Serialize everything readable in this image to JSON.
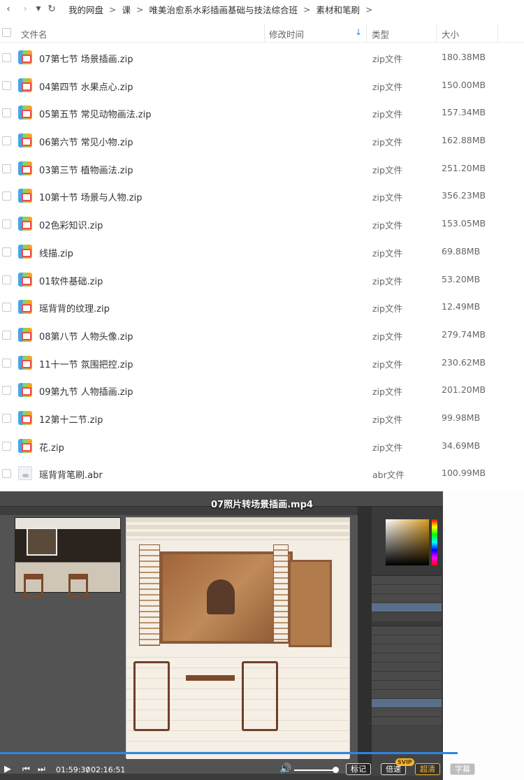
{
  "breadcrumb": {
    "back_icon": "chevron-left-icon",
    "forward_icon": "chevron-right-icon",
    "history_icon": "caret-down-icon",
    "refresh_icon": "refresh-icon",
    "items": [
      "我的网盘",
      "课",
      "唯美治愈系水彩插画基础与技法综合班",
      "素材和笔刷"
    ],
    "separator": ">"
  },
  "table": {
    "headers": {
      "name": "文件名",
      "mtime": "修改时间",
      "type": "类型",
      "size": "大小"
    },
    "sort_icon": "arrow-down-icon",
    "rows": [
      {
        "name": "07第七节 场景插画.zip",
        "type": "zip文件",
        "size": "180.38MB",
        "icon": "zip-file-icon"
      },
      {
        "name": "04第四节 水果点心.zip",
        "type": "zip文件",
        "size": "150.00MB",
        "icon": "zip-file-icon"
      },
      {
        "name": "05第五节 常见动物画法.zip",
        "type": "zip文件",
        "size": "157.34MB",
        "icon": "zip-file-icon"
      },
      {
        "name": "06第六节 常见小物.zip",
        "type": "zip文件",
        "size": "162.88MB",
        "icon": "zip-file-icon"
      },
      {
        "name": "03第三节 植物画法.zip",
        "type": "zip文件",
        "size": "251.20MB",
        "icon": "zip-file-icon"
      },
      {
        "name": "10第十节 场景与人物.zip",
        "type": "zip文件",
        "size": "356.23MB",
        "icon": "zip-file-icon"
      },
      {
        "name": "02色彩知识.zip",
        "type": "zip文件",
        "size": "153.05MB",
        "icon": "zip-file-icon"
      },
      {
        "name": "线描.zip",
        "type": "zip文件",
        "size": "69.88MB",
        "icon": "zip-file-icon"
      },
      {
        "name": "01软件基础.zip",
        "type": "zip文件",
        "size": "53.20MB",
        "icon": "zip-file-icon"
      },
      {
        "name": "瑶背背的纹理.zip",
        "type": "zip文件",
        "size": "12.49MB",
        "icon": "zip-file-icon"
      },
      {
        "name": "08第八节 人物头像.zip",
        "type": "zip文件",
        "size": "279.74MB",
        "icon": "zip-file-icon"
      },
      {
        "name": "11十一节 氛围把控.zip",
        "type": "zip文件",
        "size": "230.62MB",
        "icon": "zip-file-icon"
      },
      {
        "name": "09第九节 人物插画.zip",
        "type": "zip文件",
        "size": "201.20MB",
        "icon": "zip-file-icon"
      },
      {
        "name": "12第十二节.zip",
        "type": "zip文件",
        "size": "99.98MB",
        "icon": "zip-file-icon"
      },
      {
        "name": "花.zip",
        "type": "zip文件",
        "size": "34.69MB",
        "icon": "zip-file-icon"
      },
      {
        "name": "瑶背背笔刷.abr",
        "type": "abr文件",
        "size": "100.99MB",
        "icon": "abr-file-icon"
      }
    ]
  },
  "player": {
    "title": "07照片转场景插画.mp4",
    "current_time": "01:59:30",
    "time_sep": "/",
    "duration": "02:16:51",
    "progress": 0.873,
    "volume": 1.0,
    "buttons": {
      "bookmark": "标记",
      "speed": "倍速",
      "hd": "超清",
      "subtitle": "字幕"
    },
    "svip_badge": "SVIP",
    "accent_color": "#2b87e3",
    "vip_color": "#f5b72b"
  }
}
